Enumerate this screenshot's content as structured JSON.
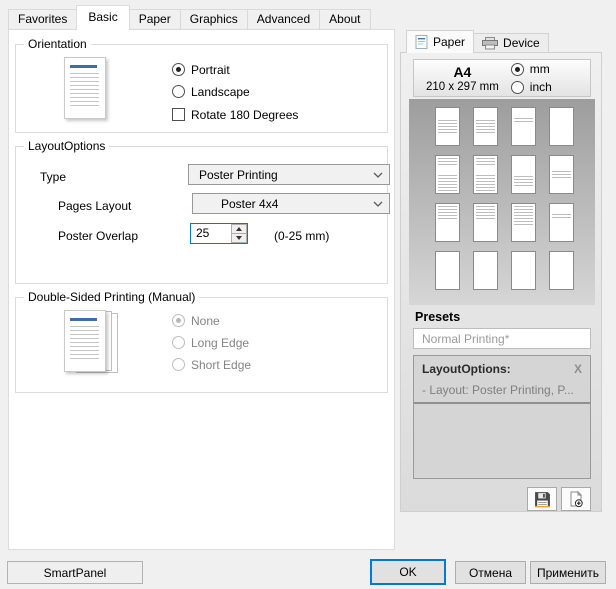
{
  "main_tabs": [
    {
      "label": "Favorites"
    },
    {
      "label": "Basic"
    },
    {
      "label": "Paper"
    },
    {
      "label": "Graphics"
    },
    {
      "label": "Advanced"
    },
    {
      "label": "About"
    }
  ],
  "orientation": {
    "title": "Orientation",
    "portrait_label": "Portrait",
    "landscape_label": "Landscape",
    "rotate_label": "Rotate 180 Degrees"
  },
  "layout_options": {
    "title": "LayoutOptions",
    "type_label": "Type",
    "type_value": "Poster Printing",
    "pages_layout_label": "Pages Layout",
    "pages_layout_value": "Poster 4x4",
    "overlap_label": "Poster Overlap",
    "overlap_value": "25",
    "overlap_hint": "(0-25 mm)"
  },
  "double_sided": {
    "title": "Double-Sided Printing (Manual)",
    "none_label": "None",
    "long_label": "Long Edge",
    "short_label": "Short Edge"
  },
  "side_tabs": [
    {
      "label": "Paper",
      "icon": "paper-icon"
    },
    {
      "label": "Device",
      "icon": "printer-icon"
    }
  ],
  "paper_info": {
    "size": "A4",
    "dims": "210 x 297 mm",
    "unit_mm": "mm",
    "unit_inch": "inch"
  },
  "presets": {
    "title": "Presets",
    "name": "Normal Printing*",
    "box_title": "LayoutOptions:",
    "box_item": "- Layout: Poster Printing, P...",
    "close": "X"
  },
  "footer": {
    "smartpanel": "SmartPanel",
    "ok": "OK",
    "cancel": "Отмена",
    "apply": "Применить"
  },
  "colors": {
    "accent": "#0078d7"
  }
}
